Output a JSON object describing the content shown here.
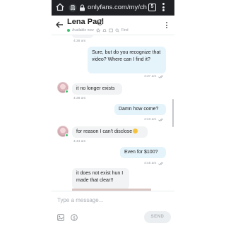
{
  "browser": {
    "url": "onlyfans.com/my/ch",
    "tab_count": "5"
  },
  "header": {
    "name": "Lena Paul",
    "status": "Available now",
    "find_label": "Find"
  },
  "messages": [
    {
      "direction": "in",
      "text": "",
      "time": "4:36 am"
    },
    {
      "direction": "out",
      "text": "Sure, but do you recognize that video? Where can I find it?",
      "time": "4:37 am"
    },
    {
      "direction": "in",
      "text": "it no longer exists",
      "time": "4:38 am"
    },
    {
      "direction": "out",
      "text": "Damn how come?",
      "time": "4:43 am"
    },
    {
      "direction": "in",
      "text": "for reason I can't disclose",
      "time": "4:44 am"
    },
    {
      "direction": "out",
      "text": "Even for $100?",
      "time": "4:45 am"
    },
    {
      "direction": "in",
      "text": "it does not exist hun I made that clear!!",
      "time": ""
    }
  ],
  "composer": {
    "placeholder": "Type a message...",
    "send_label": "SEND"
  },
  "colors": {
    "outgoing_bubble": "#e5f3fb",
    "incoming_bubble": "#f1f3f4",
    "online": "#3ec06f",
    "browser_bar": "#202124"
  }
}
